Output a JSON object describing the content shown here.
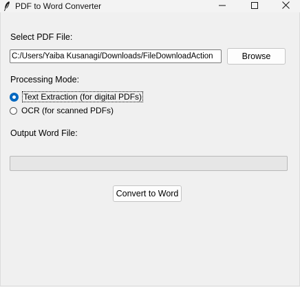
{
  "window": {
    "title": "PDF to Word Converter",
    "icons": {
      "app": "feather-icon",
      "minimize": "minimize-icon",
      "maximize": "maximize-icon",
      "close": "close-icon"
    }
  },
  "pdf_section": {
    "label": "Select PDF File:",
    "path_value": "C:/Users/Yaiba Kusanagi/Downloads/FileDownloadAction",
    "browse_label": "Browse"
  },
  "mode_section": {
    "label": "Processing Mode:",
    "options": [
      {
        "label": "Text Extraction (for digital PDFs)",
        "selected": true
      },
      {
        "label": "OCR (for scanned PDFs)",
        "selected": false
      }
    ]
  },
  "output_section": {
    "label": "Output Word File:",
    "value": ""
  },
  "actions": {
    "convert_label": "Convert to Word"
  },
  "colors": {
    "background": "#f0f0f0",
    "accent": "#0067c0"
  }
}
